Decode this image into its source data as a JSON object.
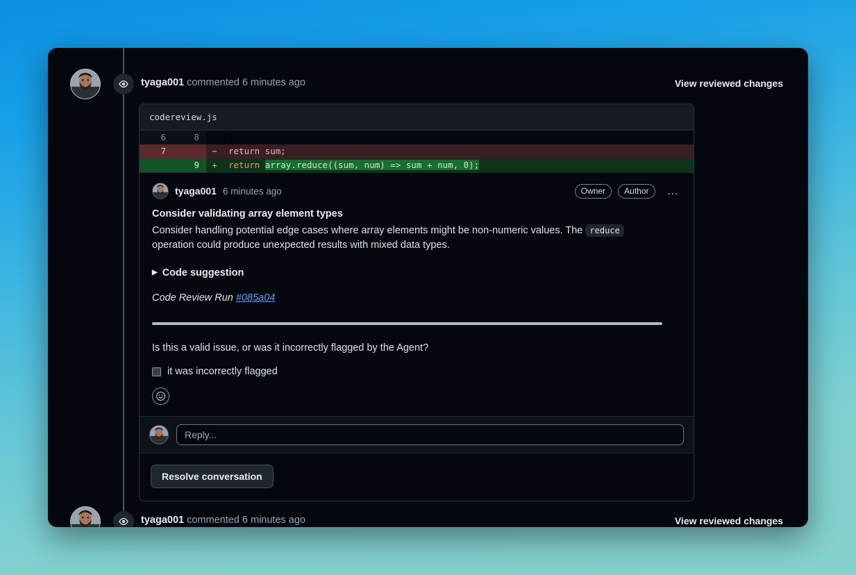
{
  "theme": {
    "bg_top": "#0a8fe0",
    "bg_bottom": "#85d1cd",
    "window_bg": "#04070d",
    "accent_link": "#58a6ff",
    "diff_add_bg": "#0d3319",
    "diff_del_bg": "#3a1f22"
  },
  "timeline": {
    "top_event": {
      "author": "tyaga001",
      "action": "commented 6 minutes ago",
      "view_changes_label": "View reviewed changes",
      "icon": "eye-icon"
    },
    "bottom_event": {
      "author": "tyaga001",
      "action": "commented 6 minutes ago",
      "view_changes_label": "View reviewed changes",
      "icon": "eye-icon"
    }
  },
  "diff": {
    "filename": "codereview.js",
    "rows": [
      {
        "type": "context",
        "old_line": "6",
        "new_line": "8",
        "sign": "",
        "code": "}"
      },
      {
        "type": "deletion",
        "old_line": "7",
        "new_line": "",
        "sign": "−",
        "code": "return sum;"
      },
      {
        "type": "addition",
        "old_line": "",
        "new_line": "9",
        "sign": "+",
        "code": "return array.reduce((sum, num) => sum + num, 0);",
        "code_keyword": "return ",
        "code_highlight": "array.reduce((sum, num) => sum + num, 0);"
      }
    ]
  },
  "comment": {
    "author": "tyaga001",
    "timestamp": "6 minutes ago",
    "badges": [
      "Owner",
      "Author"
    ],
    "menu_icon": "kebab-menu-icon",
    "title": "Consider validating array element types",
    "body_part1": "Consider handling potential edge cases where array elements might be non-numeric values. The ",
    "body_code": "reduce",
    "body_part2": " operation could produce unexpected results with mixed data types.",
    "suggestion_label": "Code suggestion",
    "suggestion_disclosure_icon": "triangle-right-icon",
    "run_label": "Code Review Run ",
    "run_link": "#085a04",
    "feedback_question": "Is this a valid issue, or was it incorrectly flagged by the Agent?",
    "checkbox_label": "it was incorrectly flagged",
    "checkbox_checked": false,
    "reaction_icon": "smiley-face-icon"
  },
  "reply": {
    "placeholder": "Reply...",
    "value": "",
    "avatar": "user-avatar"
  },
  "actions": {
    "resolve_label": "Resolve conversation"
  }
}
